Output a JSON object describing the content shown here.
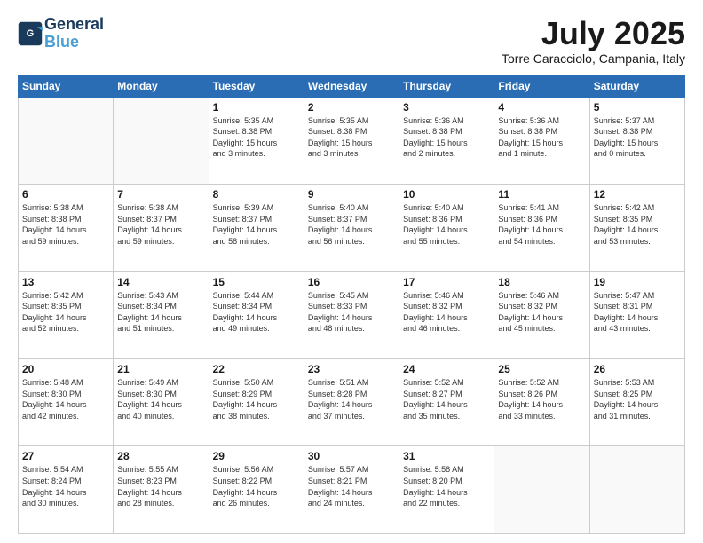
{
  "header": {
    "logo_line1": "General",
    "logo_line2": "Blue",
    "month_title": "July 2025",
    "location": "Torre Caracciolo, Campania, Italy"
  },
  "weekdays": [
    "Sunday",
    "Monday",
    "Tuesday",
    "Wednesday",
    "Thursday",
    "Friday",
    "Saturday"
  ],
  "weeks": [
    [
      {
        "day": "",
        "info": ""
      },
      {
        "day": "",
        "info": ""
      },
      {
        "day": "1",
        "info": "Sunrise: 5:35 AM\nSunset: 8:38 PM\nDaylight: 15 hours\nand 3 minutes."
      },
      {
        "day": "2",
        "info": "Sunrise: 5:35 AM\nSunset: 8:38 PM\nDaylight: 15 hours\nand 3 minutes."
      },
      {
        "day": "3",
        "info": "Sunrise: 5:36 AM\nSunset: 8:38 PM\nDaylight: 15 hours\nand 2 minutes."
      },
      {
        "day": "4",
        "info": "Sunrise: 5:36 AM\nSunset: 8:38 PM\nDaylight: 15 hours\nand 1 minute."
      },
      {
        "day": "5",
        "info": "Sunrise: 5:37 AM\nSunset: 8:38 PM\nDaylight: 15 hours\nand 0 minutes."
      }
    ],
    [
      {
        "day": "6",
        "info": "Sunrise: 5:38 AM\nSunset: 8:38 PM\nDaylight: 14 hours\nand 59 minutes."
      },
      {
        "day": "7",
        "info": "Sunrise: 5:38 AM\nSunset: 8:37 PM\nDaylight: 14 hours\nand 59 minutes."
      },
      {
        "day": "8",
        "info": "Sunrise: 5:39 AM\nSunset: 8:37 PM\nDaylight: 14 hours\nand 58 minutes."
      },
      {
        "day": "9",
        "info": "Sunrise: 5:40 AM\nSunset: 8:37 PM\nDaylight: 14 hours\nand 56 minutes."
      },
      {
        "day": "10",
        "info": "Sunrise: 5:40 AM\nSunset: 8:36 PM\nDaylight: 14 hours\nand 55 minutes."
      },
      {
        "day": "11",
        "info": "Sunrise: 5:41 AM\nSunset: 8:36 PM\nDaylight: 14 hours\nand 54 minutes."
      },
      {
        "day": "12",
        "info": "Sunrise: 5:42 AM\nSunset: 8:35 PM\nDaylight: 14 hours\nand 53 minutes."
      }
    ],
    [
      {
        "day": "13",
        "info": "Sunrise: 5:42 AM\nSunset: 8:35 PM\nDaylight: 14 hours\nand 52 minutes."
      },
      {
        "day": "14",
        "info": "Sunrise: 5:43 AM\nSunset: 8:34 PM\nDaylight: 14 hours\nand 51 minutes."
      },
      {
        "day": "15",
        "info": "Sunrise: 5:44 AM\nSunset: 8:34 PM\nDaylight: 14 hours\nand 49 minutes."
      },
      {
        "day": "16",
        "info": "Sunrise: 5:45 AM\nSunset: 8:33 PM\nDaylight: 14 hours\nand 48 minutes."
      },
      {
        "day": "17",
        "info": "Sunrise: 5:46 AM\nSunset: 8:32 PM\nDaylight: 14 hours\nand 46 minutes."
      },
      {
        "day": "18",
        "info": "Sunrise: 5:46 AM\nSunset: 8:32 PM\nDaylight: 14 hours\nand 45 minutes."
      },
      {
        "day": "19",
        "info": "Sunrise: 5:47 AM\nSunset: 8:31 PM\nDaylight: 14 hours\nand 43 minutes."
      }
    ],
    [
      {
        "day": "20",
        "info": "Sunrise: 5:48 AM\nSunset: 8:30 PM\nDaylight: 14 hours\nand 42 minutes."
      },
      {
        "day": "21",
        "info": "Sunrise: 5:49 AM\nSunset: 8:30 PM\nDaylight: 14 hours\nand 40 minutes."
      },
      {
        "day": "22",
        "info": "Sunrise: 5:50 AM\nSunset: 8:29 PM\nDaylight: 14 hours\nand 38 minutes."
      },
      {
        "day": "23",
        "info": "Sunrise: 5:51 AM\nSunset: 8:28 PM\nDaylight: 14 hours\nand 37 minutes."
      },
      {
        "day": "24",
        "info": "Sunrise: 5:52 AM\nSunset: 8:27 PM\nDaylight: 14 hours\nand 35 minutes."
      },
      {
        "day": "25",
        "info": "Sunrise: 5:52 AM\nSunset: 8:26 PM\nDaylight: 14 hours\nand 33 minutes."
      },
      {
        "day": "26",
        "info": "Sunrise: 5:53 AM\nSunset: 8:25 PM\nDaylight: 14 hours\nand 31 minutes."
      }
    ],
    [
      {
        "day": "27",
        "info": "Sunrise: 5:54 AM\nSunset: 8:24 PM\nDaylight: 14 hours\nand 30 minutes."
      },
      {
        "day": "28",
        "info": "Sunrise: 5:55 AM\nSunset: 8:23 PM\nDaylight: 14 hours\nand 28 minutes."
      },
      {
        "day": "29",
        "info": "Sunrise: 5:56 AM\nSunset: 8:22 PM\nDaylight: 14 hours\nand 26 minutes."
      },
      {
        "day": "30",
        "info": "Sunrise: 5:57 AM\nSunset: 8:21 PM\nDaylight: 14 hours\nand 24 minutes."
      },
      {
        "day": "31",
        "info": "Sunrise: 5:58 AM\nSunset: 8:20 PM\nDaylight: 14 hours\nand 22 minutes."
      },
      {
        "day": "",
        "info": ""
      },
      {
        "day": "",
        "info": ""
      }
    ]
  ]
}
